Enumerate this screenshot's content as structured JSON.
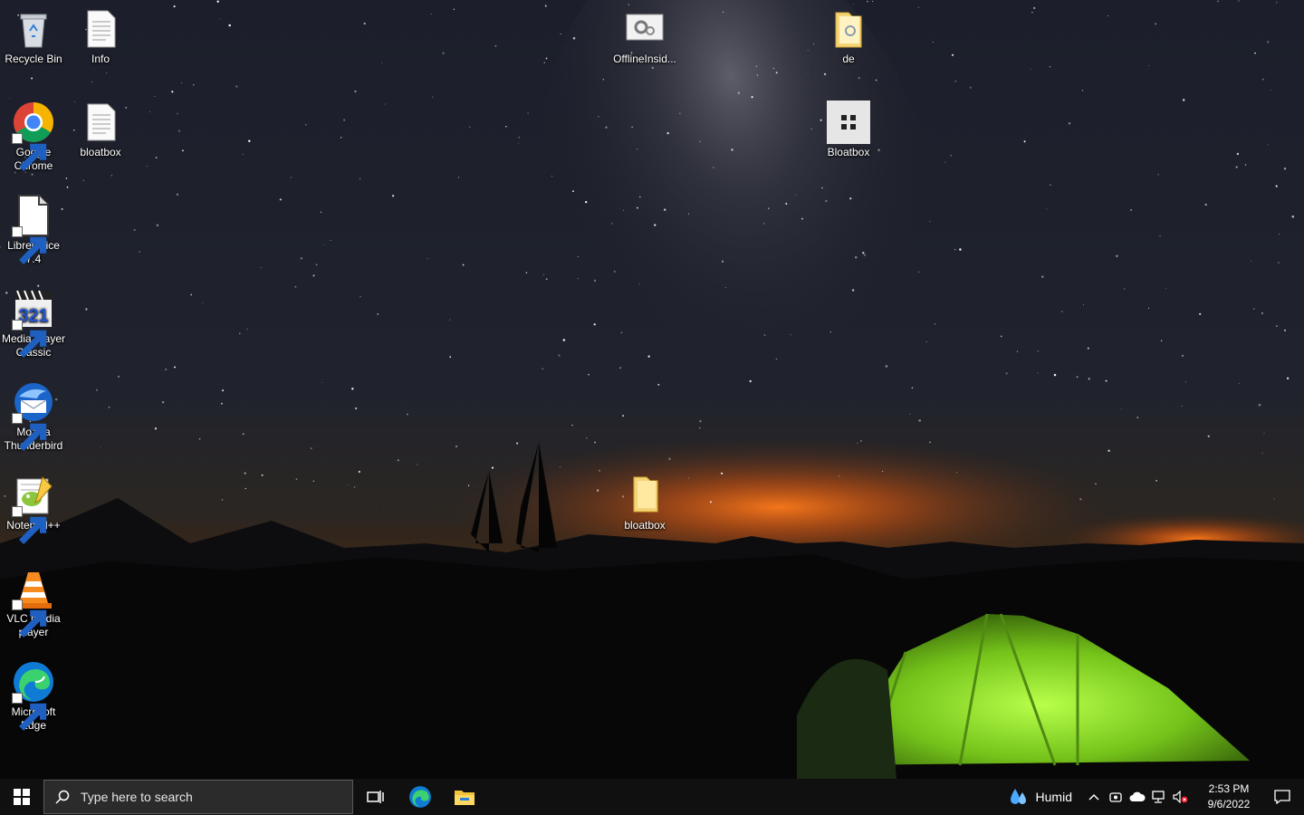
{
  "desktop": {
    "icons": [
      {
        "id": "recycle",
        "label": "Recycle Bin"
      },
      {
        "id": "info",
        "label": "Info"
      },
      {
        "id": "offline",
        "label": "OfflineInsid..."
      },
      {
        "id": "de",
        "label": "de"
      },
      {
        "id": "chrome",
        "label": "Google Chrome"
      },
      {
        "id": "bloat_doc",
        "label": "bloatbox"
      },
      {
        "id": "bloatbox_app",
        "label": "Bloatbox"
      },
      {
        "id": "libre",
        "label": "LibreOffice 7.4"
      },
      {
        "id": "mpc",
        "label": "Media Player Classic"
      },
      {
        "id": "thunderbird",
        "label": "Mozilla Thunderbird"
      },
      {
        "id": "bloat_folder",
        "label": "bloatbox"
      },
      {
        "id": "notepad",
        "label": "Notepad++"
      },
      {
        "id": "vlc",
        "label": "VLC media player"
      },
      {
        "id": "edge",
        "label": "Microsoft Edge"
      }
    ]
  },
  "taskbar": {
    "search_placeholder": "Type here to search",
    "weather": "Humid",
    "time": "2:53 PM",
    "date": "9/6/2022"
  },
  "colors": {
    "taskbar_bg": "#101010",
    "search_bg": "#2b2b2b",
    "tent": "#7ed321",
    "sky": "#141827"
  }
}
